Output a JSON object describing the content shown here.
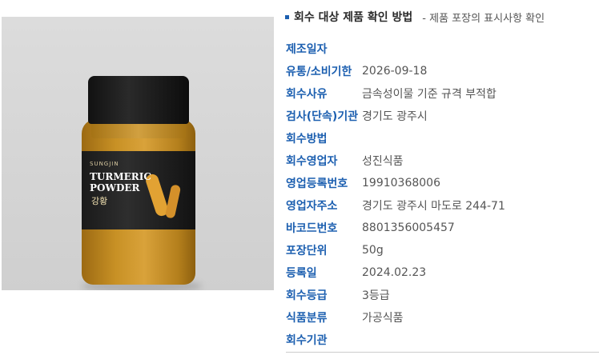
{
  "header": {
    "title": "회수 대상 제품 확인 방법",
    "subtitle": "- 제품 포장의 표시사항 확인"
  },
  "product_image": {
    "label_brand": "SUNGJIN",
    "label_line1": "TURMERIC",
    "label_line2": "POWDER",
    "label_line3": "강황"
  },
  "details": [
    {
      "label": "제조일자",
      "value": ""
    },
    {
      "label": "유통/소비기한",
      "value": "2026-09-18"
    },
    {
      "label": "회수사유",
      "value": "금속성이물 기준 규격 부적합"
    },
    {
      "label": "검사(단속)기관",
      "value": "경기도 광주시"
    },
    {
      "label": "회수방법",
      "value": ""
    },
    {
      "label": "회수영업자",
      "value": "성진식품"
    },
    {
      "label": "영업등록번호",
      "value": "19910368006"
    },
    {
      "label": "영업자주소",
      "value": "경기도 광주시 마도로 244-71"
    },
    {
      "label": "바코드번호",
      "value": "8801356005457"
    },
    {
      "label": "포장단위",
      "value": "50g"
    },
    {
      "label": "등록일",
      "value": "2024.02.23"
    },
    {
      "label": "회수등급",
      "value": "3등급"
    },
    {
      "label": "식품분류",
      "value": "가공식품"
    },
    {
      "label": "회수기관",
      "value": ""
    }
  ],
  "colors": {
    "label_blue": "#1c5fb0",
    "value_gray": "#555555",
    "title_dark": "#2a2a2a"
  }
}
